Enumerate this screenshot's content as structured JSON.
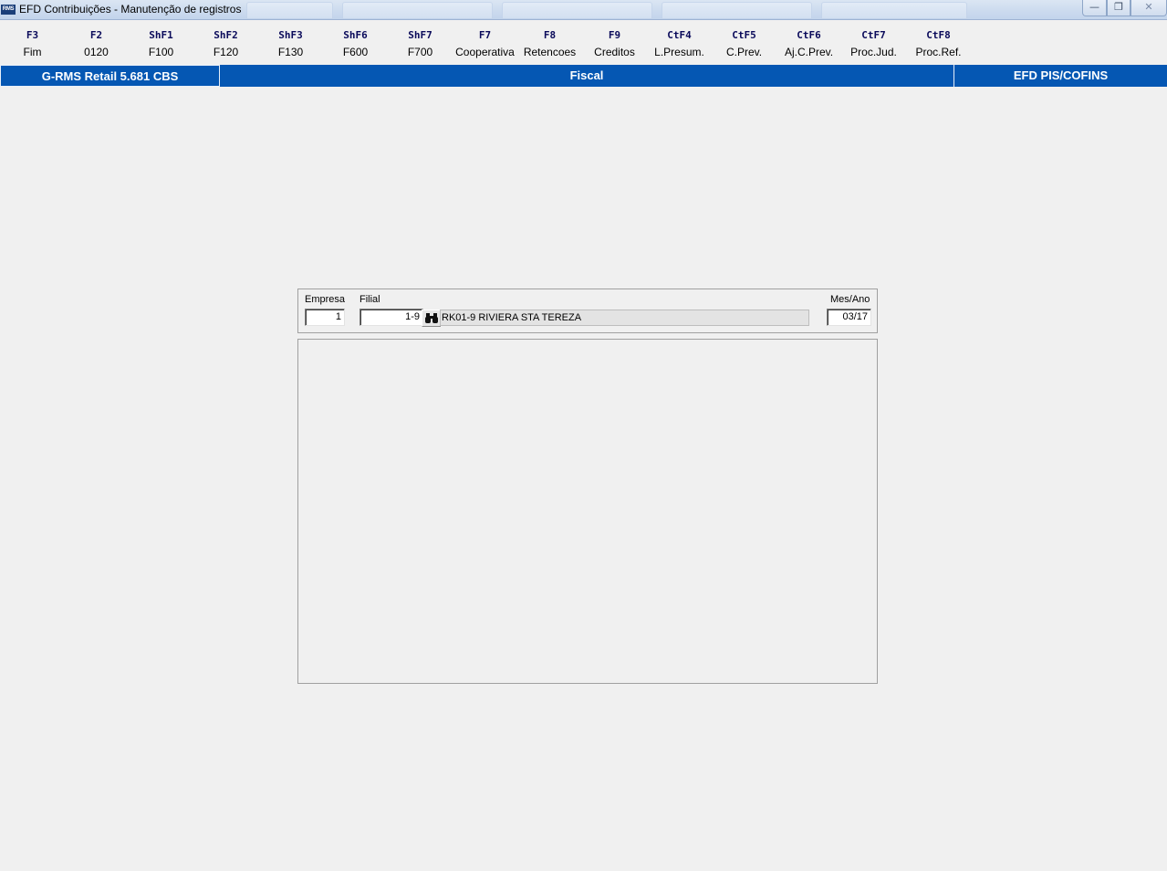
{
  "window": {
    "title": "EFD Contribuições - Manutenção de registros",
    "app_icon_text": "RMS"
  },
  "fkeys": [
    {
      "key": "F3",
      "label": "Fim"
    },
    {
      "key": "F2",
      "label": "0120"
    },
    {
      "key": "ShF1",
      "label": "F100"
    },
    {
      "key": "ShF2",
      "label": "F120"
    },
    {
      "key": "ShF3",
      "label": "F130"
    },
    {
      "key": "ShF6",
      "label": "F600"
    },
    {
      "key": "ShF7",
      "label": "F700"
    },
    {
      "key": "F7",
      "label": "Cooperativa"
    },
    {
      "key": "F8",
      "label": "Retencoes"
    },
    {
      "key": "F9",
      "label": "Creditos"
    },
    {
      "key": "CtF4",
      "label": "L.Presum."
    },
    {
      "key": "CtF5",
      "label": "C.Prev."
    },
    {
      "key": "CtF6",
      "label": "Aj.C.Prev."
    },
    {
      "key": "CtF7",
      "label": "Proc.Jud."
    },
    {
      "key": "CtF8",
      "label": "Proc.Ref."
    }
  ],
  "header": {
    "system": "G-RMS Retail 5.681 CBS",
    "module": "Fiscal",
    "screen": "EFD PIS/COFINS"
  },
  "form": {
    "empresa_label": "Empresa",
    "empresa_value": "1",
    "filial_label": "Filial",
    "filial_value": "1-9",
    "filial_description": "RK01-9 RIVIERA STA TEREZA",
    "mesano_label": "Mes/Ano",
    "mesano_value": "03/17"
  },
  "icons": {
    "search": "binoculars-icon",
    "minimize": "minimize-icon",
    "restore": "restore-icon",
    "close": "close-icon"
  },
  "colors": {
    "header_blue": "#0557b3",
    "fkey_text": "#0a0a5a",
    "background": "#f0f0f0"
  }
}
